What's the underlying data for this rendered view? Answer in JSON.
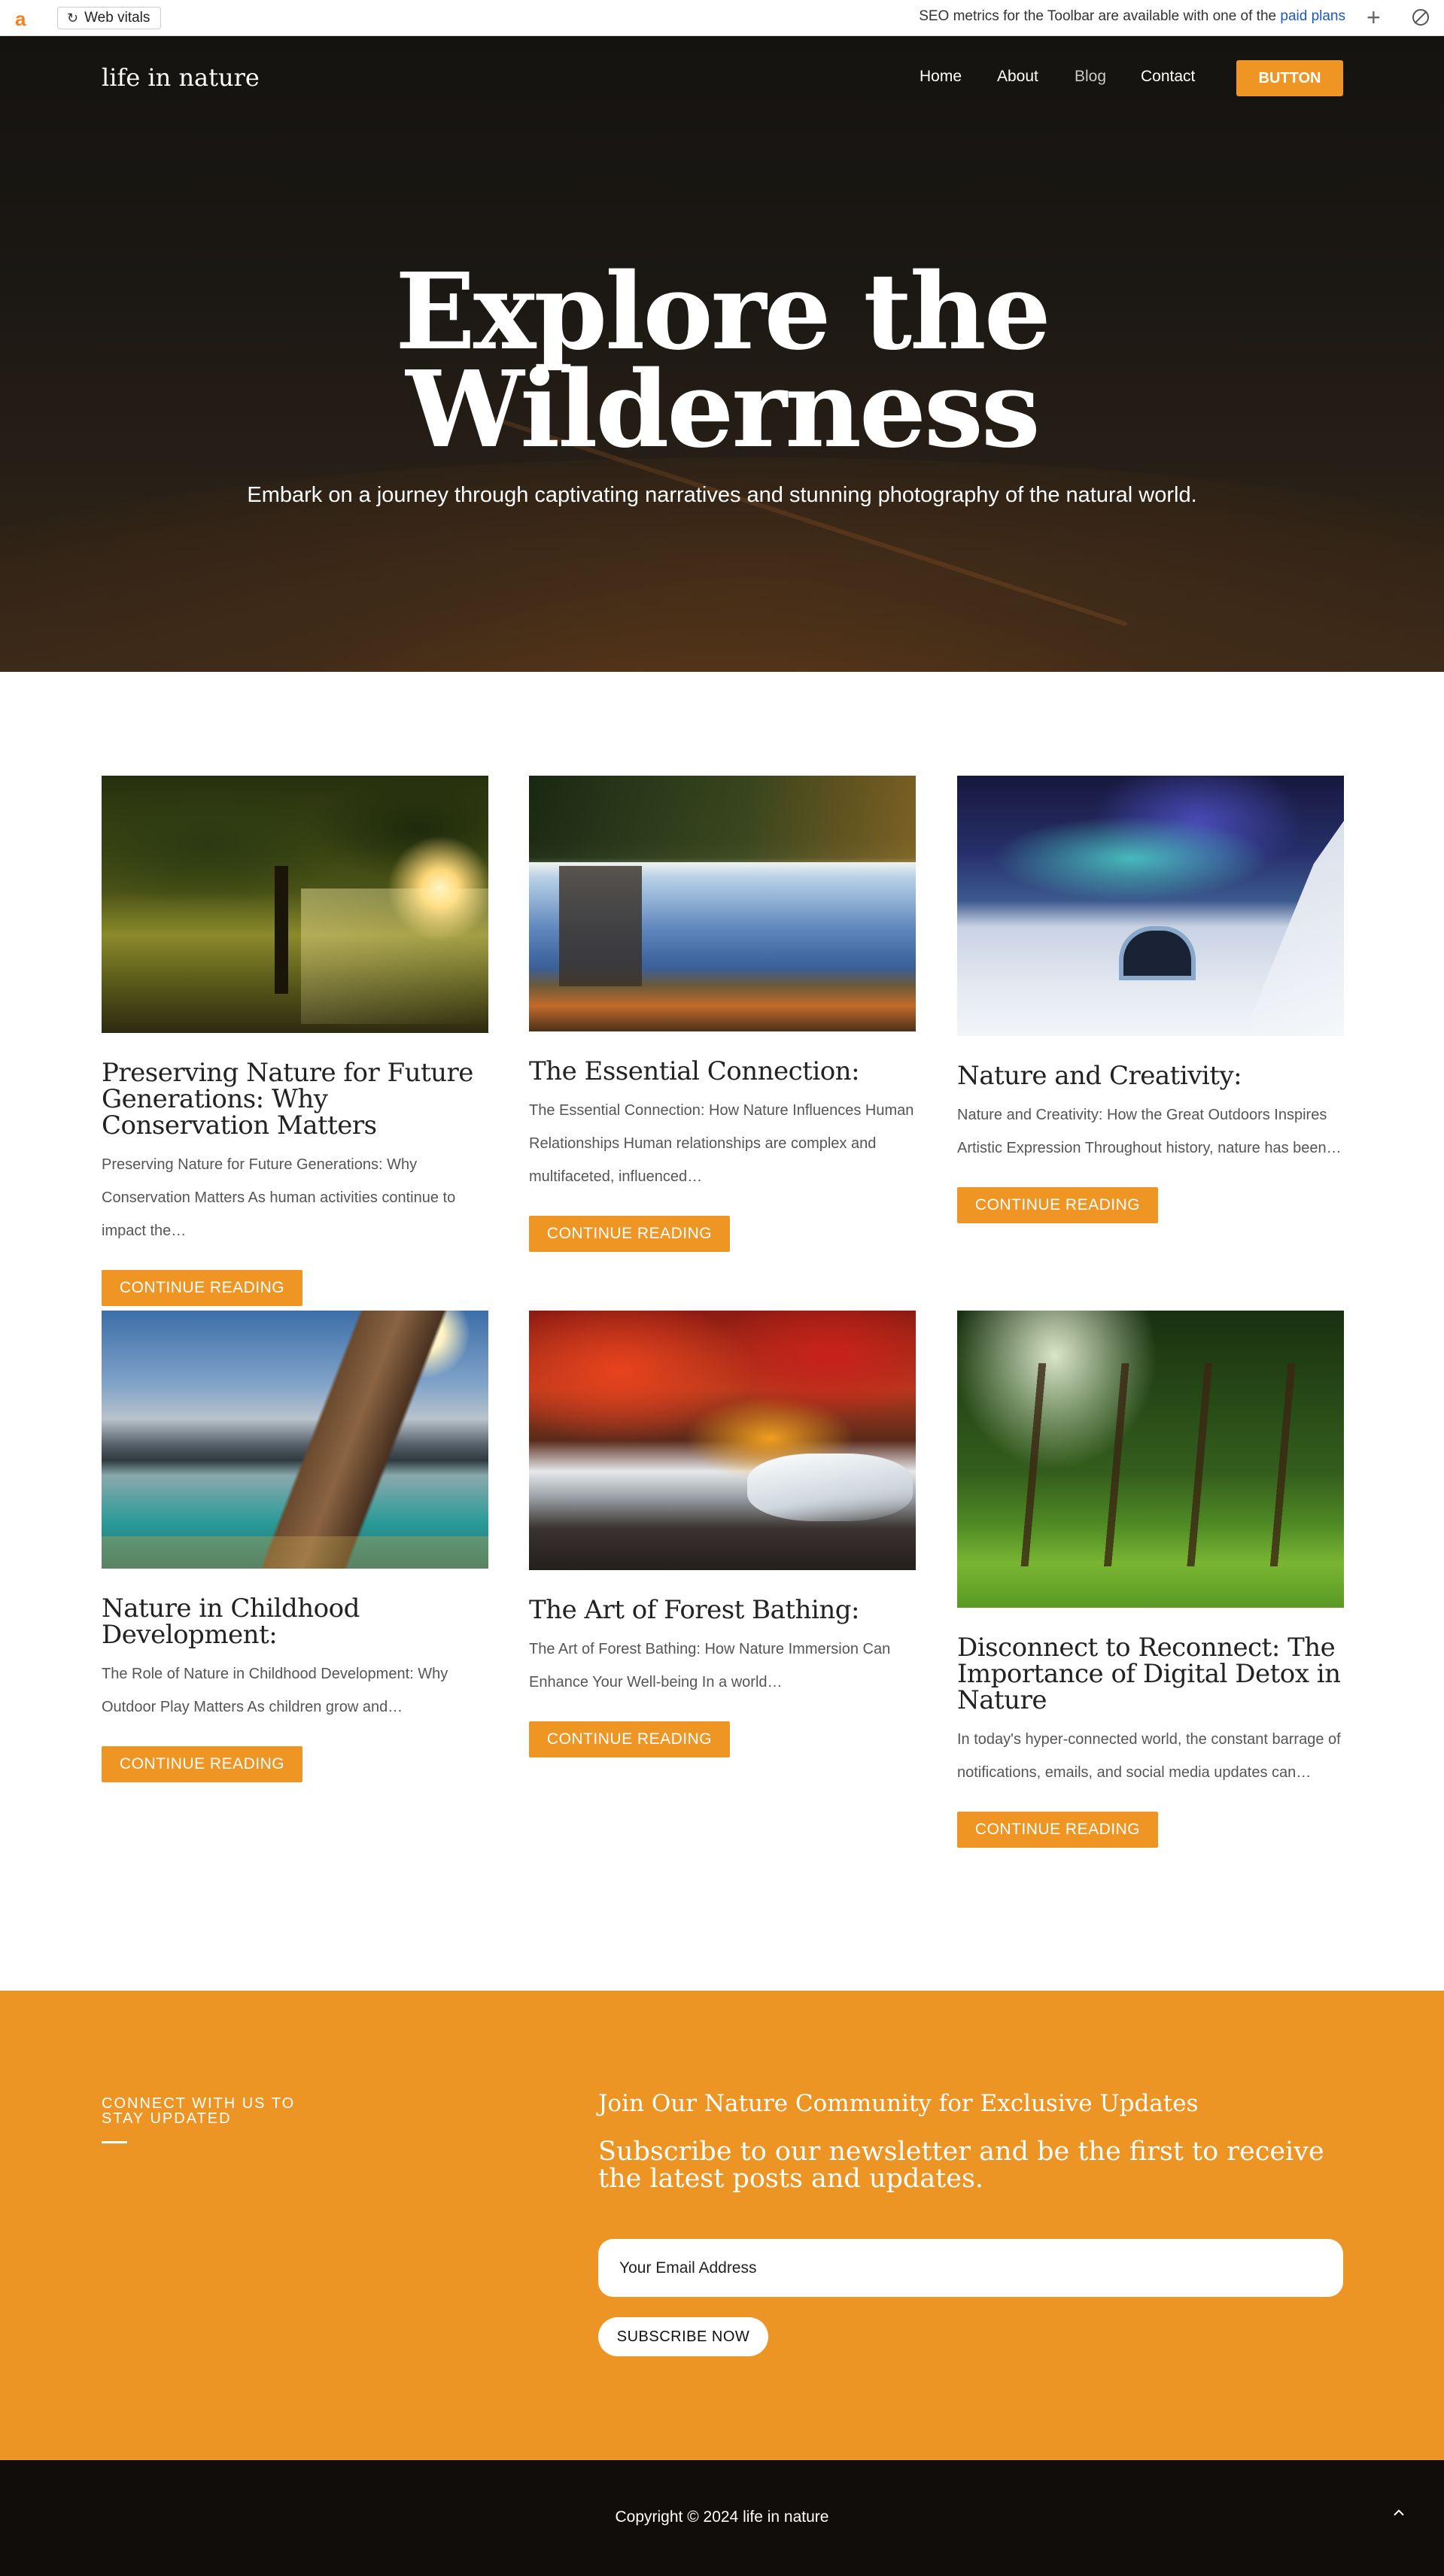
{
  "toolbar": {
    "logo": "a",
    "web_vitals_label": "Web vitals",
    "seo_text": "SEO metrics for the Toolbar are available with one of the",
    "seo_link": "paid plans",
    "plus_icon": "+",
    "refresh_icon": "C"
  },
  "header": {
    "brand": "life in nature",
    "nav": [
      "Home",
      "About",
      "Blog",
      "Contact"
    ],
    "button": "BUTTON"
  },
  "hero": {
    "title": "Explore the Wilderness",
    "subtitle": "Embark on a journey through captivating narratives and stunning photography of the natural world."
  },
  "posts": [
    {
      "title": "Preserving Nature for Future Generations: Why Conservation Matters",
      "excerpt": "Preserving Nature for Future Generations: Why Conservation Matters As human activities continue to impact the…",
      "button": "CONTINUE READING"
    },
    {
      "title": "The Essential Connection:",
      "excerpt": "The Essential Connection: How Nature Influences Human Relationships Human relationships are complex and multifaceted, influenced…",
      "button": "CONTINUE READING"
    },
    {
      "title": "Nature and Creativity:",
      "excerpt": "Nature and Creativity: How the Great Outdoors Inspires Artistic Expression Throughout history, nature has been…",
      "button": "CONTINUE READING"
    },
    {
      "title": "Nature in Childhood Development:",
      "excerpt": "The Role of Nature in Childhood Development: Why Outdoor Play Matters As children grow and…",
      "button": "CONTINUE READING"
    },
    {
      "title": "The Art of Forest Bathing:",
      "excerpt": "The Art of Forest Bathing: How Nature Immersion Can Enhance Your Well-being In a world…",
      "button": "CONTINUE READING"
    },
    {
      "title": "Disconnect to Reconnect: The Importance of Digital Detox in Nature",
      "excerpt": "In today's hyper-connected world, the constant barrage of notifications, emails, and social media updates can…",
      "button": "CONTINUE READING"
    }
  ],
  "newsletter": {
    "connect_label": "CONNECT WITH US TO STAY UPDATED",
    "title": "Join Our Nature Community for Exclusive Updates",
    "subtitle": "Subscribe to our newsletter and be the first to receive the latest posts and updates.",
    "email_placeholder": "Your Email Address",
    "button": "SUBSCRIBE NOW"
  },
  "footer": {
    "copyright": "Copyright © 2024 life in nature",
    "to_top_icon": "^"
  },
  "colors": {
    "accent": "#ee9523",
    "hero_bg": "#151310",
    "footer_bg": "#110d0a"
  }
}
